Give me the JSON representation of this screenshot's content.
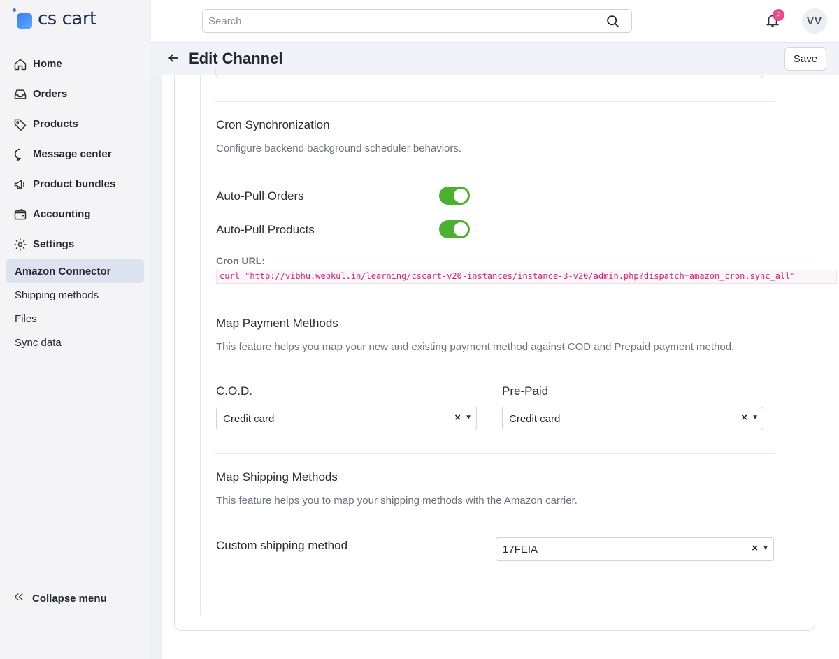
{
  "app": {
    "logo_text": "cs cart"
  },
  "sidebar": {
    "items": [
      {
        "label": "Home",
        "icon": "home-icon"
      },
      {
        "label": "Orders",
        "icon": "inbox-icon"
      },
      {
        "label": "Products",
        "icon": "tag-icon"
      },
      {
        "label": "Message center",
        "icon": "chat-icon"
      },
      {
        "label": "Product bundles",
        "icon": "megaphone-icon"
      },
      {
        "label": "Accounting",
        "icon": "wallet-icon"
      },
      {
        "label": "Settings",
        "icon": "gear-icon"
      }
    ],
    "subitems": [
      {
        "label": "Amazon Connector",
        "active": true
      },
      {
        "label": "Shipping methods",
        "active": false
      },
      {
        "label": "Files",
        "active": false
      },
      {
        "label": "Sync data",
        "active": false
      }
    ],
    "collapse_label": "Collapse menu"
  },
  "topbar": {
    "search_placeholder": "Search",
    "notifications_count": "2",
    "avatar_initials": "VV"
  },
  "header": {
    "title": "Edit Channel",
    "save_label": "Save"
  },
  "cron": {
    "title": "Cron Synchronization",
    "description": "Configure backend background scheduler behaviors.",
    "auto_pull_orders_label": "Auto-Pull Orders",
    "auto_pull_orders_on": true,
    "auto_pull_products_label": "Auto-Pull Products",
    "auto_pull_products_on": true,
    "url_label": "Cron URL:",
    "url_value": "curl \"http://vibhu.webkul.in/learning/cscart-v20-instances/instance-3-v20/admin.php?dispatch=amazon_cron.sync_all\""
  },
  "payment": {
    "title": "Map Payment Methods",
    "description": "This feature helps you map your new and existing payment method against COD and Prepaid payment method.",
    "cod_label": "C.O.D.",
    "cod_value": "Credit card",
    "prepaid_label": "Pre-Paid",
    "prepaid_value": "Credit card"
  },
  "shipping": {
    "title": "Map Shipping Methods",
    "description": "This feature helps you to map your shipping methods with the Amazon carrier.",
    "custom_label": "Custom shipping method",
    "custom_value": "17FEIA"
  },
  "colors": {
    "toggle_on": "#4caf2e",
    "badge": "#e84a8a",
    "active_nav": "#dde3ee",
    "code_text": "#d6247a"
  }
}
